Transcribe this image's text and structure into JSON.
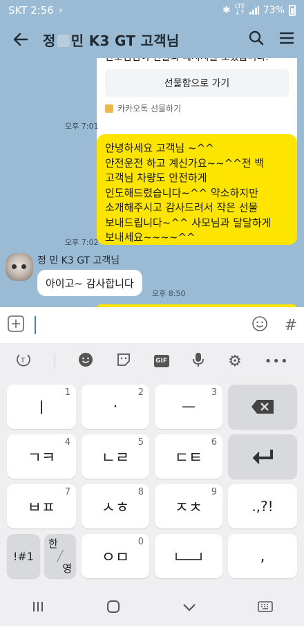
{
  "status_bar": {
    "carrier_time": "SKT 2:56",
    "battery": "73%"
  },
  "header": {
    "title_part1": "정",
    "title_part2": "민 K3 GT  고객님"
  },
  "chat": {
    "gift_card": {
      "message": "안모님님이 선물과 메시지를 보냈습니다.",
      "button": "선물함으로 가기",
      "footer": "카카오톡 선물하기",
      "time": "오후 7:01"
    },
    "my_message": {
      "text": "안녕하세요 고객님 ~^^\n안전운전 하고 계신가요~~^^전 백\n고객님 차량도 안전하게\n인도해드렸습니다~^^  약소하지만\n소개해주시고 감사드려서 작은 선물\n보내드립니다~^^ 사모님과 달달하게\n보내세요~~~~^^",
      "time": "오후 7:02"
    },
    "reply": {
      "sender": "정   민 K3 GT  고객님",
      "text": "아이고~ 감사합니다",
      "time": "오후 8:50"
    }
  },
  "input": {
    "placeholder": ""
  },
  "keyboard": {
    "rows": [
      [
        {
          "label": "ㅣ",
          "num": "1"
        },
        {
          "label": "·",
          "num": "2"
        },
        {
          "label": "ㅡ",
          "num": "3"
        }
      ],
      [
        {
          "label": "ㄱㅋ",
          "num": "4"
        },
        {
          "label": "ㄴㄹ",
          "num": "5"
        },
        {
          "label": "ㄷㅌ",
          "num": "6"
        }
      ],
      [
        {
          "label": "ㅂㅍ",
          "num": "7"
        },
        {
          "label": "ㅅㅎ",
          "num": "8"
        },
        {
          "label": "ㅈㅊ",
          "num": "9"
        }
      ]
    ],
    "punct": ".,?!",
    "symbols": "!#1",
    "lang_top": "한",
    "lang_bottom": "영",
    "zero_label": "ㅇㅁ",
    "zero_num": "0",
    "comma": ","
  }
}
